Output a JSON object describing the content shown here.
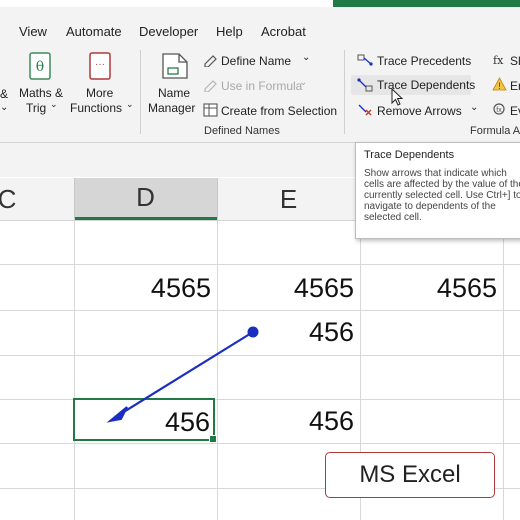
{
  "menu_tabs": [
    "View",
    "Automate",
    "Developer",
    "Help",
    "Acrobat"
  ],
  "ribbon": {
    "partial_amp": "&",
    "maths_trig": [
      "Maths &",
      "Trig"
    ],
    "more_functions": [
      "More",
      "Functions"
    ],
    "name_manager": [
      "Name",
      "Manager"
    ],
    "define_name": "Define Name",
    "use_in_formula": "Use in Formula",
    "create_from_selection": "Create from Selection",
    "defined_names_group": "Defined Names",
    "trace_precedents": "Trace Precedents",
    "trace_dependents": "Trace Dependents",
    "remove_arrows": "Remove Arrows",
    "formula_auditing_group": "Formula A",
    "show_partial": "Sh",
    "error_partial": "Er",
    "eval_partial": "Ev"
  },
  "columns": [
    "C",
    "D",
    "E"
  ],
  "cells": {
    "d1": "4565",
    "e1": "4565",
    "f1": "4565",
    "e2": "456",
    "d4": "456",
    "e4": "456"
  },
  "tooltip": {
    "title": "Trace Dependents",
    "description": "Show arrows that indicate which cells are affected by the value of the currently selected cell. Use Ctrl+] to navigate to dependents of the selected cell."
  },
  "caption": "MS Excel",
  "colors": {
    "excel_green": "#1f7a45",
    "arrow_blue": "#1a2fc2",
    "caption_border": "#b03a3a"
  }
}
